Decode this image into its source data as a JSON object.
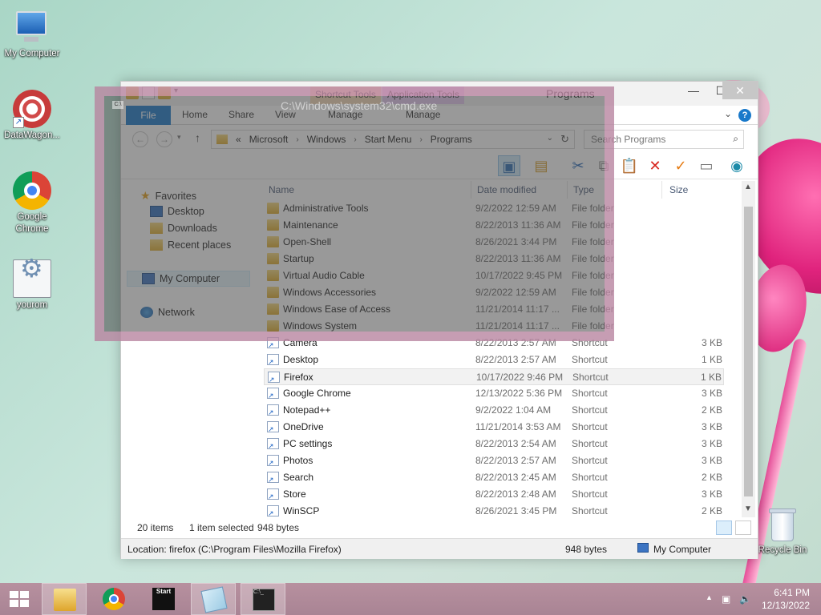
{
  "desktop": {
    "icons": [
      {
        "label": "My Computer"
      },
      {
        "label": "DataWagon..."
      },
      {
        "label": "Google Chrome"
      },
      {
        "label": "yourom"
      },
      {
        "label": "Recycle Bin"
      }
    ]
  },
  "window": {
    "title": "Programs",
    "context_tabs": {
      "shortcut_tools": "Shortcut Tools",
      "application_tools": "Application Tools"
    },
    "ribbon_tabs": [
      "File",
      "Home",
      "Share",
      "View",
      "Manage",
      "Manage"
    ],
    "breadcrumb": {
      "prefix": "«",
      "parts": [
        "Microsoft",
        "Windows",
        "Start Menu",
        "Programs"
      ]
    },
    "search_placeholder": "Search Programs",
    "nav": {
      "favorites": "Favorites",
      "desktop": "Desktop",
      "downloads": "Downloads",
      "recent": "Recent places",
      "my_computer": "My Computer",
      "network": "Network"
    },
    "columns": {
      "name": "Name",
      "date": "Date modified",
      "type": "Type",
      "size": "Size"
    },
    "files": [
      {
        "name": "Administrative Tools",
        "date": "9/2/2022 12:59 AM",
        "type": "File folder",
        "size": "",
        "kind": "folder"
      },
      {
        "name": "Maintenance",
        "date": "8/22/2013 11:36 AM",
        "type": "File folder",
        "size": "",
        "kind": "folder"
      },
      {
        "name": "Open-Shell",
        "date": "8/26/2021 3:44 PM",
        "type": "File folder",
        "size": "",
        "kind": "folder"
      },
      {
        "name": "Startup",
        "date": "8/22/2013 11:36 AM",
        "type": "File folder",
        "size": "",
        "kind": "folder"
      },
      {
        "name": "Virtual Audio Cable",
        "date": "10/17/2022 9:45 PM",
        "type": "File folder",
        "size": "",
        "kind": "folder"
      },
      {
        "name": "Windows Accessories",
        "date": "9/2/2022 12:59 AM",
        "type": "File folder",
        "size": "",
        "kind": "folder"
      },
      {
        "name": "Windows Ease of Access",
        "date": "11/21/2014 11:17 ...",
        "type": "File folder",
        "size": "",
        "kind": "folder"
      },
      {
        "name": "Windows System",
        "date": "11/21/2014 11:17 ...",
        "type": "File folder",
        "size": "",
        "kind": "folder"
      },
      {
        "name": "Camera",
        "date": "8/22/2013 2:57 AM",
        "type": "Shortcut",
        "size": "3 KB",
        "kind": "shortcut"
      },
      {
        "name": "Desktop",
        "date": "8/22/2013 2:57 AM",
        "type": "Shortcut",
        "size": "1 KB",
        "kind": "shortcut"
      },
      {
        "name": "Firefox",
        "date": "10/17/2022 9:46 PM",
        "type": "Shortcut",
        "size": "1 KB",
        "kind": "shortcut",
        "selected": true
      },
      {
        "name": "Google Chrome",
        "date": "12/13/2022 5:36 PM",
        "type": "Shortcut",
        "size": "3 KB",
        "kind": "shortcut"
      },
      {
        "name": "Notepad++",
        "date": "9/2/2022 1:04 AM",
        "type": "Shortcut",
        "size": "2 KB",
        "kind": "shortcut"
      },
      {
        "name": "OneDrive",
        "date": "11/21/2014 3:53 AM",
        "type": "Shortcut",
        "size": "3 KB",
        "kind": "shortcut"
      },
      {
        "name": "PC settings",
        "date": "8/22/2013 2:54 AM",
        "type": "Shortcut",
        "size": "3 KB",
        "kind": "shortcut"
      },
      {
        "name": "Photos",
        "date": "8/22/2013 2:57 AM",
        "type": "Shortcut",
        "size": "3 KB",
        "kind": "shortcut"
      },
      {
        "name": "Search",
        "date": "8/22/2013 2:45 AM",
        "type": "Shortcut",
        "size": "2 KB",
        "kind": "shortcut"
      },
      {
        "name": "Store",
        "date": "8/22/2013 2:48 AM",
        "type": "Shortcut",
        "size": "3 KB",
        "kind": "shortcut"
      },
      {
        "name": "WinSCP",
        "date": "8/26/2021 3:45 PM",
        "type": "Shortcut",
        "size": "2 KB",
        "kind": "shortcut"
      }
    ],
    "status": {
      "count": "20 items",
      "selected": "1 item selected",
      "bytes": "948 bytes"
    },
    "details": {
      "location": "Location: firefox (C:\\Program Files\\Mozilla Firefox)",
      "size": "948 bytes",
      "computer": "My Computer"
    }
  },
  "ghost_window": {
    "title": "C:\\Windows\\system32\\cmd.exe"
  },
  "taskbar": {
    "start_label": "Start",
    "time": "6:41 PM",
    "date": "12/13/2022"
  }
}
